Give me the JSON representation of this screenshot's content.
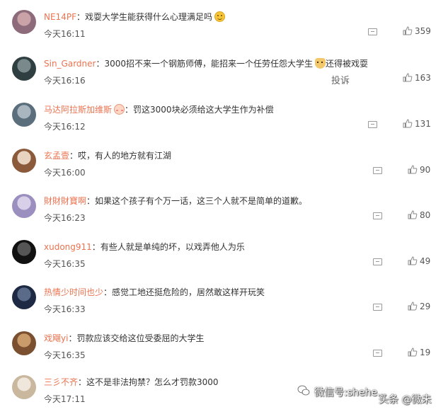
{
  "comments": [
    {
      "user": "NE14PF",
      "text": "戏耍大学生能获得什么心理满足吗",
      "emoji": "smile",
      "time": "今天16:11",
      "likes": "359",
      "report": ""
    },
    {
      "user": "Sin_Gardner",
      "text": "3000招不来一个钢筋师傅，能招来一个任劳任怨大学生",
      "emoji": "dog",
      "text_after": "还得被戏耍",
      "time": "今天16:16",
      "likes": "163",
      "report": "投诉"
    },
    {
      "user": "马达阿拉斯加维斯",
      "user_emoji": "blush",
      "text": "罚这3000块必须给这大学生作为补偿",
      "time": "今天16:12",
      "likes": "131",
      "report": ""
    },
    {
      "user": "玄孟壹",
      "text": "哎，有人的地方就有江湖",
      "time": "今天16:00",
      "likes": "90",
      "report": ""
    },
    {
      "user": "財財財寶啊",
      "text": "如果这个孩子有个万一话，这三个人就不是简单的道歉。",
      "time": "今天16:23",
      "likes": "80",
      "report": ""
    },
    {
      "user": "xudong911",
      "text": "有些人就是单纯的坏，以戏弄他人为乐",
      "time": "今天16:35",
      "likes": "49",
      "report": ""
    },
    {
      "user": "热情少时间也少",
      "text": "感觉工地还挺危险的，居然敢这样开玩笑",
      "time": "今天16:33",
      "likes": "29",
      "report": ""
    },
    {
      "user": "戏飗yi",
      "text": "罚款应该交给这位受委屈的大学生",
      "time": "今天16:35",
      "likes": "19",
      "report": ""
    },
    {
      "user": "三彡不齐",
      "text": "这不是非法拘禁？怎么才罚款3000",
      "time": "今天17:11",
      "likes": "",
      "report": ""
    }
  ],
  "separator": "：",
  "watermark": {
    "text": "微信号:shehe…",
    "text2": "头条 @微未"
  },
  "colors": {
    "username": "#eb7350",
    "text": "#333333",
    "meta": "#555555"
  }
}
